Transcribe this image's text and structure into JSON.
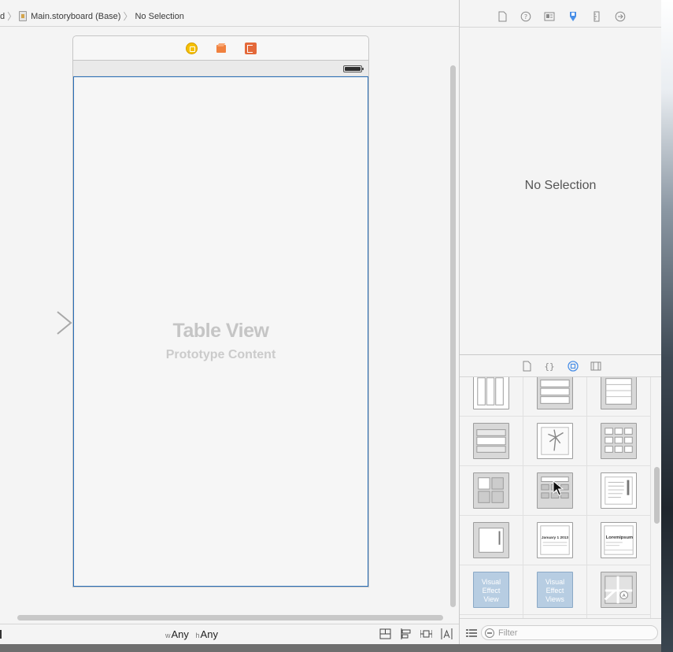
{
  "jumpbar": {
    "crumbs": [
      {
        "label": "d"
      },
      {
        "label": "Main.storyboard (Base)"
      },
      {
        "label": "No Selection"
      }
    ]
  },
  "canvas": {
    "table_view_title": "Table View",
    "table_view_subtitle": "Prototype Content"
  },
  "size_class": {
    "w_prefix": "w",
    "w_value": "Any",
    "h_prefix": "h",
    "h_value": "Any"
  },
  "inspector": {
    "empty_state": "No Selection",
    "tabs": [
      "file-inspector-icon",
      "quick-help-icon",
      "identity-inspector-icon",
      "attributes-inspector-icon",
      "size-inspector-icon",
      "connections-inspector-icon"
    ],
    "active_tab": "attributes-inspector-icon"
  },
  "library": {
    "tabs": [
      "file-template-icon",
      "code-snippet-icon",
      "object-library-icon",
      "media-library-icon"
    ],
    "active_tab": "object-library-icon",
    "visual_effect_view_label": "Visual Effect View",
    "visual_effect_views_label": "Visual Effect Views",
    "filter_placeholder": "Filter"
  },
  "colors": {
    "accent": "#2a6fb8",
    "active_tab": "#4a8fe7",
    "view_controller_icon": "#f5c000",
    "first_responder_icon": "#f0813f",
    "exit_icon": "#e4693a"
  }
}
